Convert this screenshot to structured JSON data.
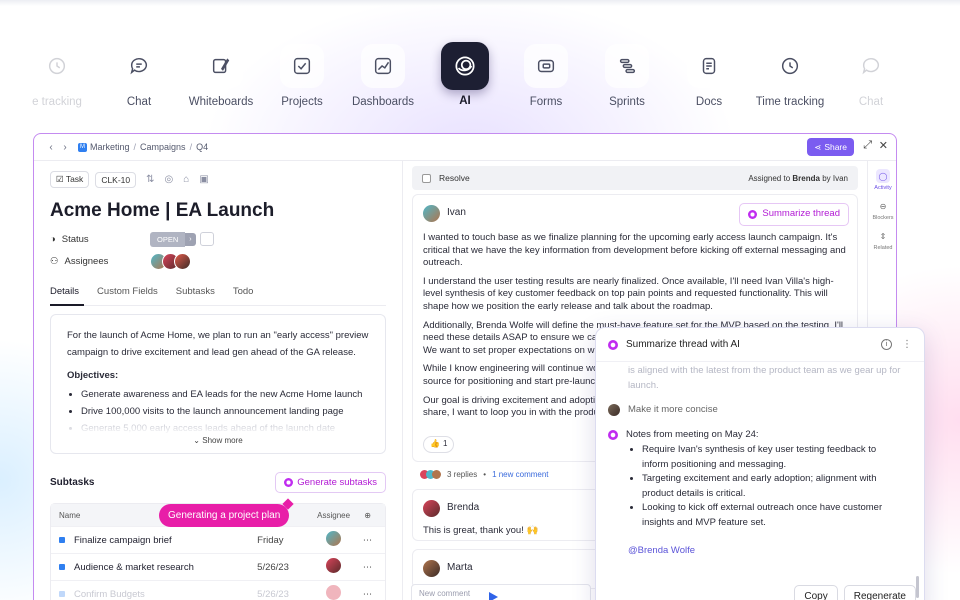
{
  "nav": {
    "items": [
      {
        "label": "e tracking",
        "icon": "clock-icon"
      },
      {
        "label": "Chat",
        "icon": "chat-icon"
      },
      {
        "label": "Whiteboards",
        "icon": "whiteboard-icon"
      },
      {
        "label": "Projects",
        "icon": "checkbox-icon"
      },
      {
        "label": "Dashboards",
        "icon": "chart-icon"
      },
      {
        "label": "AI",
        "icon": "ai-icon"
      },
      {
        "label": "Forms",
        "icon": "form-icon"
      },
      {
        "label": "Sprints",
        "icon": "sprint-icon"
      },
      {
        "label": "Docs",
        "icon": "doc-icon"
      },
      {
        "label": "Time tracking",
        "icon": "clock-icon"
      },
      {
        "label": "Chat",
        "icon": "chat-icon"
      }
    ]
  },
  "breadcrumb": {
    "workspace_badge": "M",
    "items": [
      "Marketing",
      "Campaigns",
      "Q4"
    ]
  },
  "share_label": "Share",
  "task": {
    "type_label": "Task",
    "id": "CLK-10",
    "title": "Acme Home | EA Launch",
    "status_label": "Status",
    "status_value": "OPEN",
    "assignees_label": "Assignees",
    "tabs": [
      "Details",
      "Custom Fields",
      "Subtasks",
      "Todo"
    ],
    "description": {
      "intro": "For the launch of Acme Home, we plan to run an \"early access\" preview campaign to drive excitement and lead gen ahead of the GA release.",
      "objectives_heading": "Objectives:",
      "objectives": [
        "Generate awareness and EA leads for the new Acme Home launch",
        "Drive 100,000 visits to the launch announcement landing page",
        "Generate 5,000 early access leads ahead of the launch date"
      ],
      "show_more": "Show more"
    },
    "subtasks_heading": "Subtasks",
    "generate_subtasks_label": "Generate subtasks",
    "tooltip": "Generating a project plan",
    "subtask_columns": [
      "Name",
      "Assignee"
    ],
    "subtasks": [
      {
        "name": "Finalize campaign brief",
        "date": "Friday"
      },
      {
        "name": "Audience & market research",
        "date": "5/26/23"
      },
      {
        "name": "Confirm Budgets",
        "date": "5/26/23"
      }
    ]
  },
  "thread": {
    "resolve_label": "Resolve",
    "assigned_prefix": "Assigned to",
    "assigned_to": "Brenda",
    "assigned_by_prefix": "by",
    "assigned_by": "Ivan",
    "summarize_label": "Summarize thread",
    "main_comment": {
      "author": "Ivan",
      "paragraphs": [
        "I wanted to touch base as we finalize planning for the upcoming early access launch campaign. It's critical that we have the key information from development before kicking off external messaging and outreach.",
        "I understand the user testing results are nearly finalized. Once available, I'll need Ivan Villa's high-level synthesis of key customer feedback on top pain points and requested functionality. This will shape how we position the early release and talk about the roadmap.",
        "Additionally, Brenda Wolfe will define the must-have feature set for the MVP based on the testing. I'll need these details ASAP to ensure we can finalize the marketing assets and messaging framework. We want to set proper expectations on what will be available.",
        "While I know engineering will continue work on the features and customer insights as our main source for positioning and start pre-launch engagement.",
        "Our goal is driving excitement and adoption. If you have questions or have additional details to share, I want to loop you in with the product team as we gear up for launch."
      ],
      "reaction_emoji": "👍",
      "reaction_count": "1"
    },
    "replies_label": "3 replies",
    "new_comment_label": "1 new comment",
    "replies": [
      {
        "author": "Brenda",
        "text": "This is great, thank you! 🙌"
      },
      {
        "author": "Marta",
        "text": ""
      }
    ],
    "new_comment_placeholder": "New comment"
  },
  "ai_panel": {
    "title": "Summarize thread with AI",
    "faded_text": "is aligned with the latest from the product team as we gear up for launch.",
    "user_prompt": "Make it more concise",
    "notes_heading": "Notes from meeting on May 24:",
    "notes": [
      "Require Ivan's synthesis of key user testing feedback to inform positioning and messaging.",
      "Targeting excitement and early adoption; alignment with product details is critical.",
      "Looking to kick off external outreach once have customer insights and MVP feature set."
    ],
    "mention": "@Brenda Wolfe",
    "copy_label": "Copy",
    "regenerate_label": "Regenerate"
  },
  "rail": {
    "items": [
      "Activity",
      "Blockers",
      "Related"
    ]
  },
  "colors": {
    "accent": "#7b5cf0",
    "ai_magenta": "#b21ad4",
    "tooltip": "#e81ea8",
    "link": "#3b6bdc"
  }
}
